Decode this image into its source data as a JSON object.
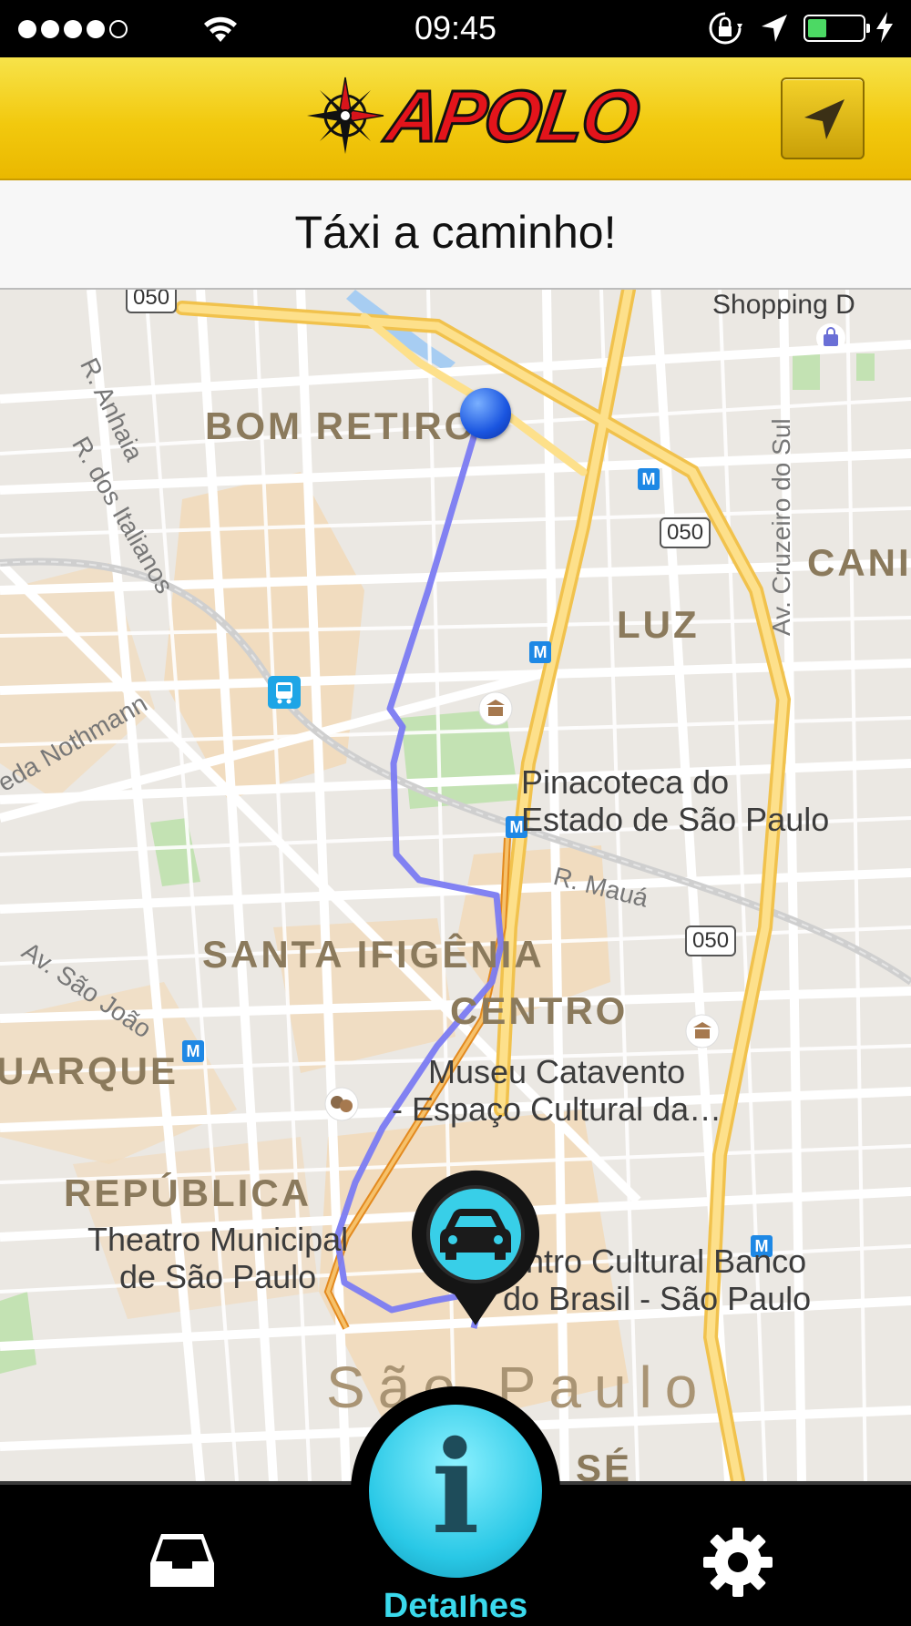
{
  "status_bar": {
    "time": "09:45",
    "battery_level": 0.4,
    "icons": [
      "signal-dots-icon",
      "wifi-icon",
      "rotation-lock-icon",
      "location-arrow-icon",
      "battery-icon",
      "charging-bolt-icon"
    ]
  },
  "header": {
    "brand": "APOLO",
    "logo_icon": "compass-rose-icon",
    "locate_button_icon": "navigation-arrow-icon"
  },
  "status_message": "Táxi a caminho!",
  "map": {
    "districts": [
      "BOM RETIRO",
      "LUZ",
      "SANTA IFIGÊNIA",
      "CENTRO",
      "REPÚBLICA",
      "CANI",
      "UARQUE",
      "São Paulo",
      "SÉ"
    ],
    "pois": [
      "Shopping D",
      "Pinacoteca do\nEstado de São Paulo",
      "Museu Catavento\n- Espaço Cultural da…",
      "Theatro Municipal\nde São Paulo",
      "entro Cultural Banco\ndo Brasil - São Paulo"
    ],
    "streets": [
      "R. dos Italianos",
      "R. Anhaia",
      "Av. Cruzeiro do Sul",
      "eda Nothmann",
      "R. Mauá",
      "Av. São João"
    ],
    "highway_shields": [
      "050",
      "050",
      "050"
    ],
    "metro_label": "M",
    "colors": {
      "route": "#7b7bf2",
      "taxi_path": "#f2a53c",
      "marker": "#1a55e0"
    }
  },
  "tab_bar": {
    "inbox_icon": "inbox-tray-icon",
    "info_icon": "info-icon",
    "info_glyph": "i",
    "active_label": "Detalhes",
    "settings_icon": "gear-icon",
    "active_color": "#3ad9ec"
  }
}
